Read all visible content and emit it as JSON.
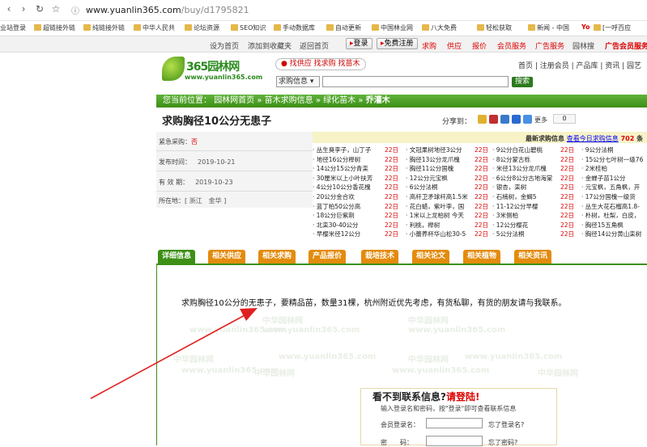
{
  "browser": {
    "url_host": "www.yuanlin365.com",
    "url_path": "/buy/d1795821",
    "bookmarks": [
      "业站登录",
      "超链接外链",
      "纯链接外链",
      "中华人民共",
      "论坛资源",
      "SEO知识",
      "手动数据库",
      "自动更新",
      "中国林业网",
      "八大免费",
      "轻松获取",
      "新闻 - 中国",
      "Yo",
      "[一呼百应"
    ]
  },
  "topbar": {
    "links": [
      "设为首页",
      "添加到收藏夹",
      "返回首页"
    ],
    "login_label": "登录",
    "register_label": "免费注册",
    "red_links": [
      "求购",
      "供应",
      "报价",
      "会员服务",
      "广告服务",
      "园林搜",
      "广告会员服务"
    ]
  },
  "header": {
    "logo_name": "365园林网",
    "logo_domain": "www.yuanlin365.com",
    "tagline": "找供应 找求购 找苗木",
    "search_select": "求购信息 ▾",
    "search_button": "搜索",
    "right_nav": "首页 | 注册会员 | 产品库 | 资讯 | 园艺"
  },
  "breadcrumb": {
    "prefix": "您当前位置：",
    "items": [
      "园林网首页",
      "苗木求购信息",
      "绿化苗木",
      "乔灌木"
    ]
  },
  "page": {
    "title": "求购胸径10公分无患子",
    "share_label": "分享到：",
    "share_more": "更多",
    "share_count": "0"
  },
  "info": {
    "urgent_label": "紧急采购：",
    "urgent_value": "否",
    "publish_label": "发布时间：",
    "publish_value": "2019-10-21",
    "valid_label": "有 效 期：",
    "valid_value": "2019-10-23",
    "location_label": "所在地：",
    "location_value": "[ 浙江　金华 ]"
  },
  "news": {
    "head": "最新求购信息",
    "link": "查看今日求购信息",
    "count": "702",
    "tail": "条",
    "columns": [
      [
        "丛生臭李子，山丁子",
        "地径16公分榉树",
        "14公分15公分青栾",
        "30厘米以上小叶扶芳",
        "4公分10公分香花槐",
        "20公分金合欢",
        "蓝丁柏50公分高",
        "18公分巨紫荆",
        "北栾30-40公分",
        "早樱米径12公分"
      ],
      [
        "文冠果树地径3公分",
        "胸径13公分龙爪槐",
        "胸径11公分国槐",
        "12公分元宝枫",
        "6公分法桐",
        "高杆卫矛球杆高1.5米",
        "花白蜡，紫叶李，国",
        "1米以上龙柏树 今天",
        "利桃，榉树",
        "小蕾养杯华山松30-5"
      ],
      [
        "9公分白花山碧桃",
        "8公分蒙古栎",
        "米径13公分龙爪槐",
        "6公分8公分古地海棠",
        "银杏，栾树",
        "石楠树，金蝎5",
        "11-12公分早樱",
        "3米侧柏",
        "12公分樱花",
        "5公分法桐"
      ],
      [
        "9公分法桐",
        "15公分七叶树一级76",
        "2米桂柏",
        "金蝉子苗1公分",
        "元宝枫，五角枫，开",
        "17公分国槐一级货",
        "丛生大花石榴高1.8-",
        "朴树，杜梨，白皮，",
        "胸径15五角枫",
        "胸径14公分黄山栾树"
      ]
    ],
    "date": "22日"
  },
  "tabs": [
    "详细信息",
    "相关供应",
    "相关求购",
    "产品报价",
    "栽培技术",
    "相关论文",
    "相关植物",
    "相关资讯"
  ],
  "content": {
    "description": "求购胸径10公分的无患子，要精品苗，数量31棵，杭州附近优先考虑，有货私聊，有货的朋友请与我联系。",
    "watermark_cn": "中华园林网",
    "watermark_en": "www.yuanlin365.com"
  },
  "login": {
    "title_a": "看不到联系信息?",
    "title_b": "请登陆!",
    "hint": "输入登录名和密码，按\"登录\"即可查看联系信息",
    "user_label": "会员登录名：",
    "user_forgot": "忘了登录名?",
    "pass_label": "密　　码：",
    "pass_forgot": "忘了密码?"
  }
}
